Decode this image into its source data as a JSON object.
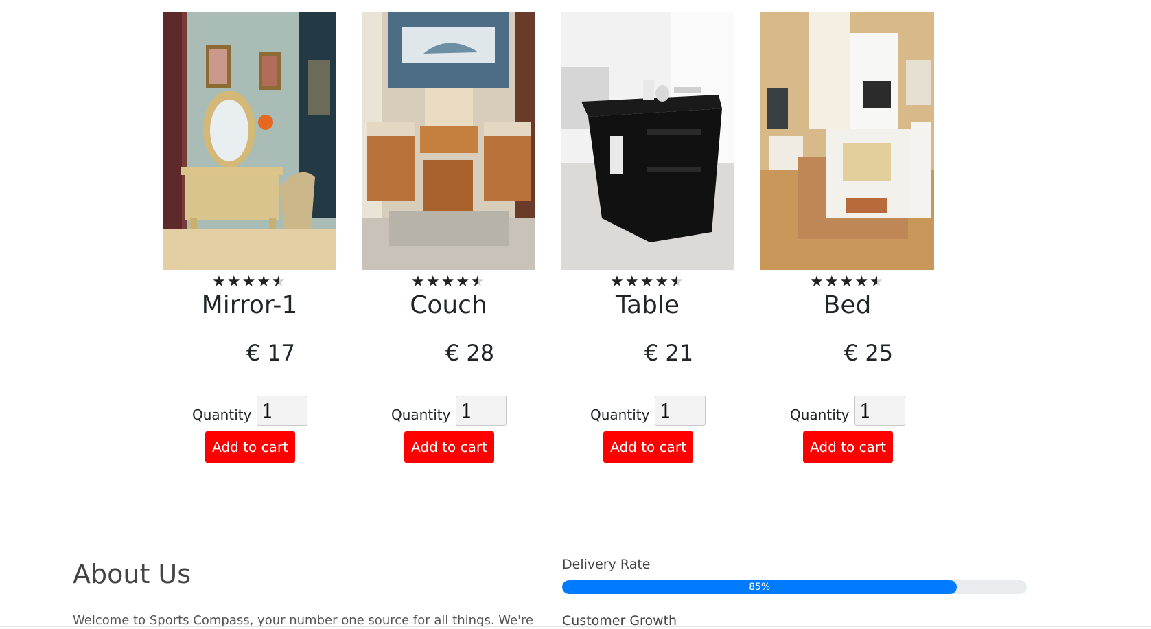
{
  "products": [
    {
      "name": "Mirror-1",
      "price": "€ 17",
      "rating": 4.5,
      "quantity_label": "Quantity",
      "quantity_value": "1",
      "button_label": "Add to cart",
      "image": "vanity-dresser-mirror-photo"
    },
    {
      "name": "Couch",
      "price": "€ 28",
      "rating": 4.5,
      "quantity_label": "Quantity",
      "quantity_value": "1",
      "button_label": "Add to cart",
      "image": "wooden-sofa-set-photo"
    },
    {
      "name": "Table",
      "price": "€ 21",
      "rating": 4.5,
      "quantity_label": "Quantity",
      "quantity_value": "1",
      "button_label": "Add to cart",
      "image": "black-side-table-photo"
    },
    {
      "name": "Bed",
      "price": "€ 25",
      "rating": 4.5,
      "quantity_label": "Quantity",
      "quantity_value": "1",
      "button_label": "Add to cart",
      "image": "bedroom-bed-photo"
    }
  ],
  "about": {
    "title": "About Us",
    "text": "Welcome to Sports Compass, your number one source for all things. We're"
  },
  "skills": [
    {
      "label": "Delivery Rate",
      "percent": 85,
      "percent_text": "85%"
    },
    {
      "label": "Customer Growth"
    }
  ],
  "colors": {
    "cart_button": "#ff0000",
    "progress": "#007bff",
    "progress_track": "#e9ecef"
  }
}
